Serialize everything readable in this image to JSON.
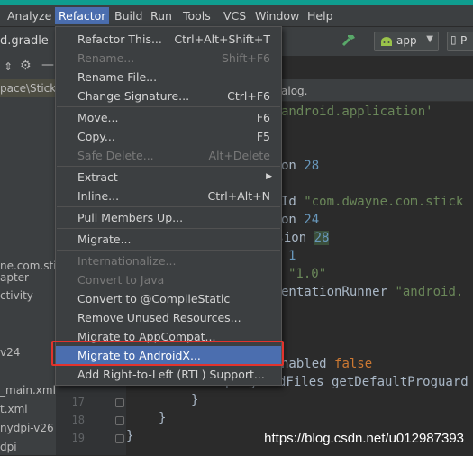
{
  "menubar": {
    "items": [
      "Analyze",
      "Refactor",
      "Build",
      "Run",
      "Tools",
      "VCS",
      "Window",
      "Help"
    ],
    "active": "Refactor"
  },
  "toolbar": {
    "file_tab": "d.gradle",
    "run_config": "app",
    "device_label": "P"
  },
  "project_panel": {
    "path": "pace\\Stick",
    "rows": [
      "ne.com.stic",
      "apter",
      "ctivity",
      "v24",
      "_main.xml",
      "t.xml",
      "nydpi-v26",
      "dpi"
    ]
  },
  "editor": {
    "tab_label": "alog.",
    "code": [
      {
        "text": "'com.android.application'",
        "tokens": [
          [
            "android.application'",
            "str"
          ]
        ]
      },
      {
        "text": "on 28"
      },
      {
        "text": "Id \"com.dwayne.com.stick"
      },
      {
        "text": "on 24"
      },
      {
        "text": "rsion 28"
      },
      {
        "text": "1"
      },
      {
        "text": "\"1.0\""
      },
      {
        "text": "entationRunner \"android."
      },
      {
        "text": "nabled false"
      },
      {
        "text": "proguardFiles getDefaultProguard"
      }
    ],
    "line_numbers": [
      "17",
      "18",
      "19"
    ],
    "line17": "}",
    "line18": "}",
    "line19": "}"
  },
  "refactor_menu": [
    {
      "label": "Refactor This...",
      "shortcut": "Ctrl+Alt+Shift+T",
      "disabled": false
    },
    {
      "label": "Rename...",
      "shortcut": "Shift+F6",
      "disabled": true
    },
    {
      "label": "Rename File...",
      "shortcut": "",
      "disabled": false
    },
    {
      "label": "Change Signature...",
      "shortcut": "Ctrl+F6",
      "disabled": false
    },
    {
      "label": "Move...",
      "shortcut": "F6",
      "disabled": false
    },
    {
      "label": "Copy...",
      "shortcut": "F5",
      "disabled": false
    },
    {
      "label": "Safe Delete...",
      "shortcut": "Alt+Delete",
      "disabled": true
    },
    {
      "label": "Extract",
      "shortcut": "",
      "disabled": false,
      "submenu": true
    },
    {
      "label": "Inline...",
      "shortcut": "Ctrl+Alt+N",
      "disabled": false
    },
    {
      "label": "Pull Members Up...",
      "shortcut": "",
      "disabled": false
    },
    {
      "label": "Migrate...",
      "shortcut": "",
      "disabled": false
    },
    {
      "label": "Internationalize...",
      "shortcut": "",
      "disabled": true
    },
    {
      "label": "Convert to Java",
      "shortcut": "",
      "disabled": true
    },
    {
      "label": "Convert to @CompileStatic",
      "shortcut": "",
      "disabled": false
    },
    {
      "label": "Remove Unused Resources...",
      "shortcut": "",
      "disabled": false
    },
    {
      "label": "Migrate to AppCompat...",
      "shortcut": "",
      "disabled": false
    },
    {
      "label": "Migrate to AndroidX...",
      "shortcut": "",
      "disabled": false,
      "selected": true
    },
    {
      "label": "Add Right-to-Left (RTL) Support...",
      "shortcut": "",
      "disabled": false
    }
  ],
  "watermark": "https://blog.csdn.net/u012987393",
  "colors": {
    "accent": "#4b6eaf",
    "highlight_box": "#e2332d",
    "strip": "#0f9d8f"
  }
}
